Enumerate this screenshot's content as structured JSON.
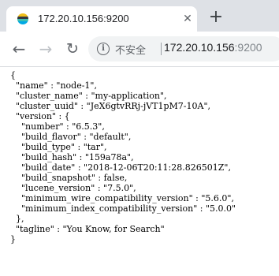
{
  "tab": {
    "title": "172.20.10.156:9200",
    "favicon_icon": "elastic-logo-icon",
    "close_glyph": "✕"
  },
  "new_tab_glyph": "+",
  "toolbar": {
    "back_glyph": "←",
    "forward_glyph": "→",
    "reload_glyph": "↻",
    "info_glyph": "i",
    "security_label": "不安全",
    "url_host": "172.20.10.156",
    "url_port": ":9200"
  },
  "response_lines": [
    "{",
    "  \"name\" : \"node-1\",",
    "  \"cluster_name\" : \"my-application\",",
    "  \"cluster_uuid\" : \"JeX6gtvRRj-jVT1pM7-10A\",",
    "  \"version\" : {",
    "    \"number\" : \"6.5.3\",",
    "    \"build_flavor\" : \"default\",",
    "    \"build_type\" : \"tar\",",
    "    \"build_hash\" : \"159a78a\",",
    "    \"build_date\" : \"2018-12-06T20:11:28.826501Z\",",
    "    \"build_snapshot\" : false,",
    "    \"lucene_version\" : \"7.5.0\",",
    "    \"minimum_wire_compatibility_version\" : \"5.6.0\",",
    "    \"minimum_index_compatibility_version\" : \"5.0.0\"",
    "  },",
    "  \"tagline\" : \"You Know, for Search\"",
    "}"
  ]
}
